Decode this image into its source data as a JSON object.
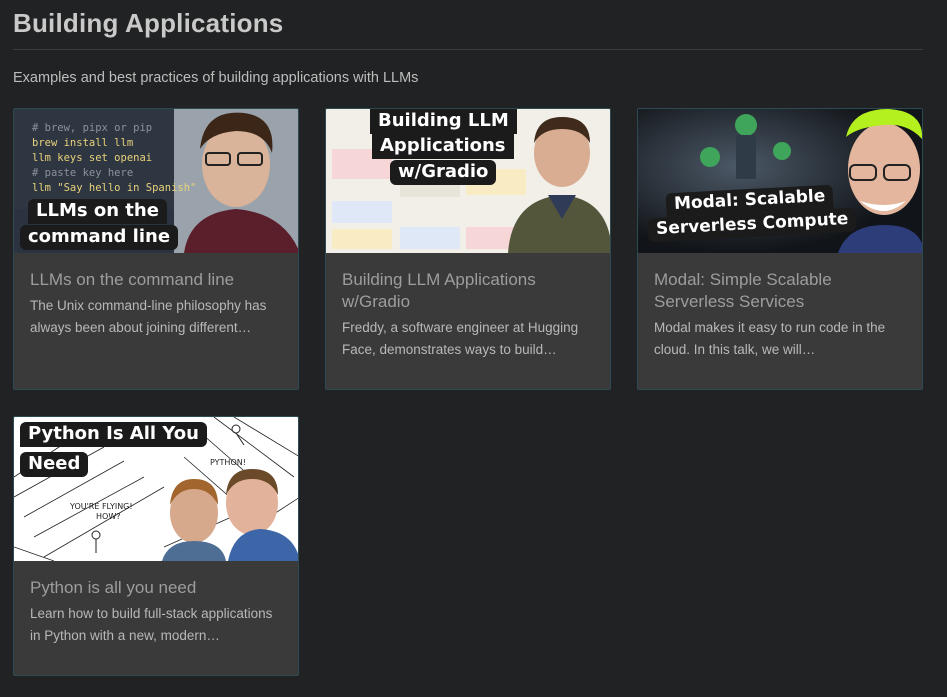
{
  "header": {
    "title": "Building Applications",
    "subtitle": "Examples and best practices of building applications with LLMs"
  },
  "cards": [
    {
      "title": "LLMs on the command line",
      "description": "The Unix command-line philosophy has always been about joining different…",
      "thumbnail_caption_lines": [
        "LLMs on the",
        "command line"
      ],
      "thumbnail_code_lines": [
        "# brew, pipx or pip",
        "brew install llm",
        "llm keys set openai",
        "# paste key here",
        "llm \"Say hello in Spanish\""
      ]
    },
    {
      "title": "Building LLM Applications w/Gradio",
      "description": "Freddy, a software engineer at Hugging Face, demonstrates ways to build…",
      "thumbnail_caption_lines": [
        "Building LLM",
        "Applications",
        "w/Gradio"
      ]
    },
    {
      "title": "Modal: Simple Scalable Serverless Services",
      "description": "Modal makes it easy to run code in the cloud. In this talk, we will…",
      "thumbnail_caption_lines": [
        "Modal: Scalable",
        "Serverless Compute"
      ]
    },
    {
      "title": "Python is all you need",
      "description": "Learn how to build full-stack applications in Python with a new, modern…",
      "thumbnail_caption_lines": [
        "Python Is All You",
        "Need"
      ],
      "thumbnail_comic_text": [
        "PYTHON!",
        "YOU'RE FLYING!",
        "HOW?"
      ]
    }
  ],
  "colors": {
    "background": "#212223",
    "card": "#3a3a3a",
    "card_border": "#2c4a52",
    "title": "#c9c9c9"
  }
}
